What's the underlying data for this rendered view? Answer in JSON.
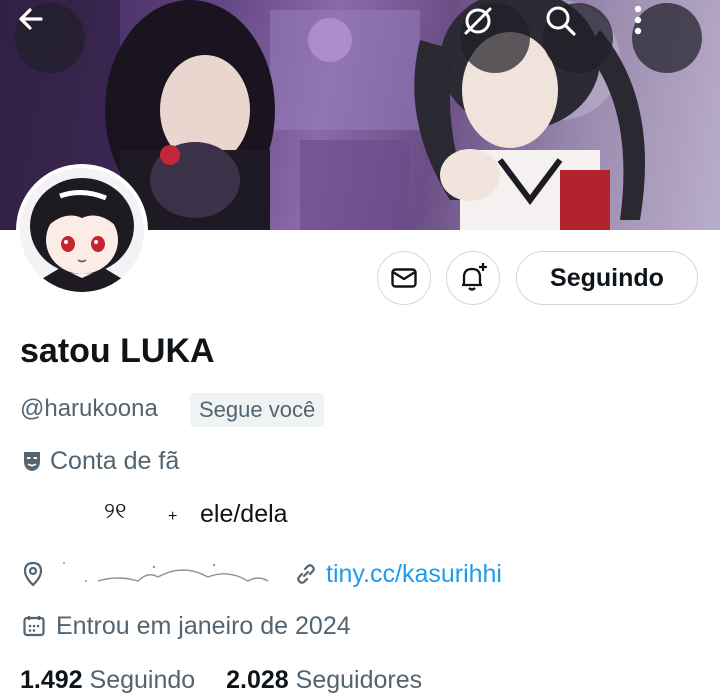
{
  "header": {
    "back_icon": "arrow-left-icon",
    "grok_icon": "grok-icon",
    "search_icon": "search-icon",
    "more_icon": "more-vertical-icon"
  },
  "profile": {
    "display_name": "satou LUKA",
    "handle": "@harukoona",
    "follows_you": "Segue você",
    "category": "Conta de fã",
    "bio_symbols": "୨୧",
    "bio_plus": "+",
    "bio_pronouns": "ele/dela",
    "link": "tiny.cc/kasurihhi",
    "joined": "Entrou em janeiro de 2024"
  },
  "actions": {
    "message_icon": "envelope-icon",
    "notify_icon": "bell-plus-icon",
    "following_label": "Seguindo"
  },
  "stats": {
    "following_count": "1.492",
    "following_label": "Seguindo",
    "followers_count": "2.028",
    "followers_label": "Seguidores"
  },
  "colors": {
    "link": "#1d9bf0",
    "muted": "#536471",
    "text": "#0f1419",
    "border": "#cfd9de"
  }
}
